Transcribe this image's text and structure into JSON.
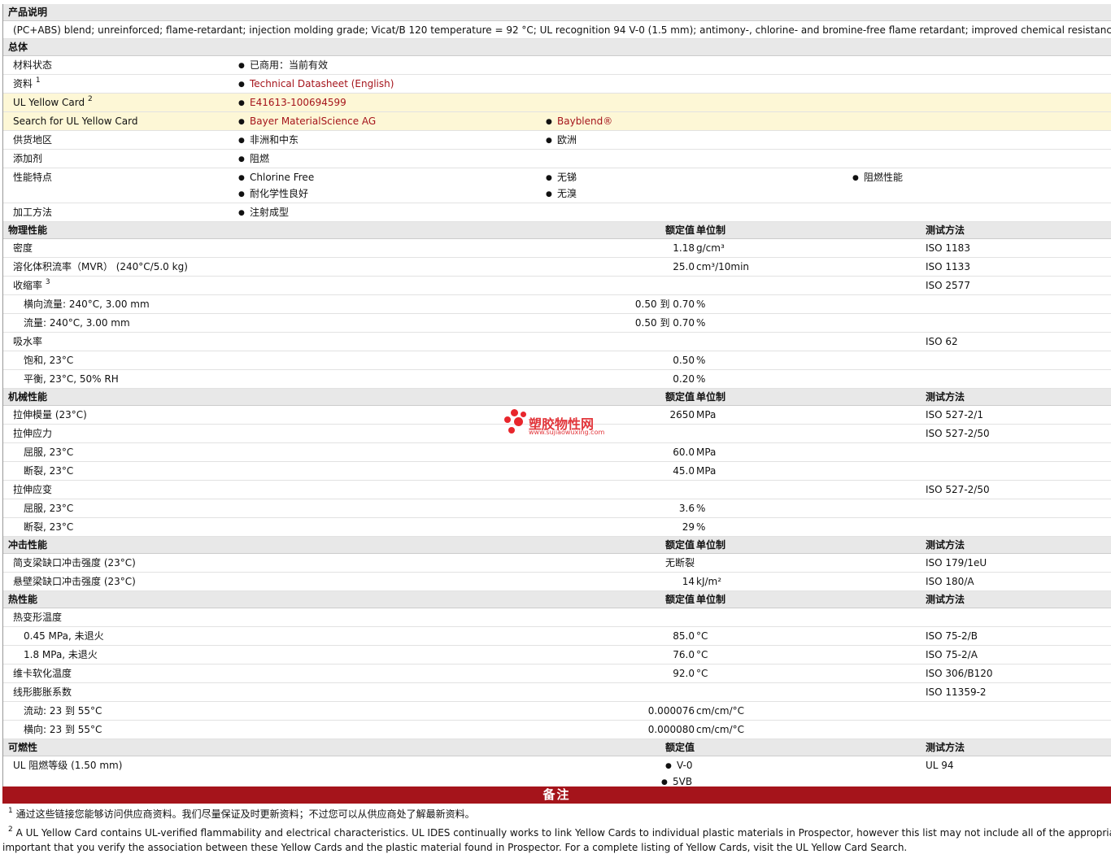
{
  "desc_header": "产品说明",
  "desc_text": "(PC+ABS) blend; unreinforced; flame-retardant; injection molding grade; Vicat/B 120 temperature = 92 °C; UL recognition 94 V-0 (1.5 mm); antimony-, chlorine- and bromine-free flame retardant; improved chemical resistance.",
  "general": {
    "header": "总体",
    "status_label": "材料状态",
    "status_value": "已商用：当前有效",
    "info_label": "资料",
    "info_sup": "1",
    "info_value": "Technical Datasheet (English)",
    "ul_label": "UL Yellow Card",
    "ul_sup": "2",
    "ul_value": "E41613-100694599",
    "search_label": "Search for UL Yellow Card",
    "search_v1": "Bayer MaterialScience AG",
    "search_v2": "Bayblend®",
    "region_label": "供货地区",
    "region_v1": "非洲和中东",
    "region_v2": "欧洲",
    "additive_label": "添加剂",
    "additive_v1": "阻燃",
    "feature_label": "性能特点",
    "feature_v1": "Chlorine Free",
    "feature_v2": "无锑",
    "feature_v3": "阻燃性能",
    "feature_v4": "耐化学性良好",
    "feature_v5": "无溴",
    "process_label": "加工方法",
    "process_v1": "注射成型"
  },
  "col_headers": {
    "value": "额定值",
    "unit": "单位制",
    "test": "测试方法"
  },
  "physical": {
    "header": "物理性能",
    "rows": [
      {
        "label": "密度",
        "value": "1.18",
        "unit": "g/cm³",
        "test": "ISO 1183"
      },
      {
        "label": "溶化体积流率（MVR） (240°C/5.0 kg)",
        "value": "25.0",
        "unit": "cm³/10min",
        "test": "ISO 1133"
      },
      {
        "label": "收缩率",
        "sup": "3",
        "value": "",
        "unit": "",
        "test": "ISO 2577"
      },
      {
        "label": "横向流量: 240°C, 3.00 mm",
        "value": "0.50 到  0.70",
        "unit": "%",
        "test": "",
        "sub": true
      },
      {
        "label": "流量: 240°C, 3.00 mm",
        "value": "0.50 到  0.70",
        "unit": "%",
        "test": "",
        "sub": true
      },
      {
        "label": "吸水率",
        "value": "",
        "unit": "",
        "test": "ISO 62"
      },
      {
        "label": "饱和, 23°C",
        "value": "0.50",
        "unit": "%",
        "test": "",
        "sub": true
      },
      {
        "label": "平衡, 23°C, 50% RH",
        "value": "0.20",
        "unit": "%",
        "test": "",
        "sub": true
      }
    ]
  },
  "mechanical": {
    "header": "机械性能",
    "rows": [
      {
        "label": "拉伸模量 (23°C)",
        "value": "2650",
        "unit": "MPa",
        "test": "ISO 527-2/1"
      },
      {
        "label": "拉伸应力",
        "value": "",
        "unit": "",
        "test": "ISO 527-2/50"
      },
      {
        "label": "屈服, 23°C",
        "value": "60.0",
        "unit": "MPa",
        "test": "",
        "sub": true
      },
      {
        "label": "断裂, 23°C",
        "value": "45.0",
        "unit": "MPa",
        "test": "",
        "sub": true
      },
      {
        "label": "拉伸应变",
        "value": "",
        "unit": "",
        "test": "ISO 527-2/50"
      },
      {
        "label": "屈服, 23°C",
        "value": "3.6",
        "unit": "%",
        "test": "",
        "sub": true
      },
      {
        "label": "断裂, 23°C",
        "value": "29",
        "unit": "%",
        "test": "",
        "sub": true
      }
    ]
  },
  "impact": {
    "header": "冲击性能",
    "rows": [
      {
        "label": "简支梁缺口冲击强度 (23°C)",
        "value": "无断裂",
        "unit": "",
        "test": "ISO 179/1eU"
      },
      {
        "label": "悬壁梁缺口冲击强度 (23°C)",
        "value": "14",
        "unit": "kJ/m²",
        "test": "ISO 180/A"
      }
    ]
  },
  "thermal": {
    "header": "热性能",
    "rows": [
      {
        "label": "热变形温度",
        "value": "",
        "unit": "",
        "test": ""
      },
      {
        "label": "0.45 MPa, 未退火",
        "value": "85.0",
        "unit": "°C",
        "test": "ISO 75-2/B",
        "sub": true
      },
      {
        "label": "1.8 MPa, 未退火",
        "value": "76.0",
        "unit": "°C",
        "test": "ISO 75-2/A",
        "sub": true
      },
      {
        "label": "维卡软化温度",
        "value": "92.0",
        "unit": "°C",
        "test": "ISO 306/B120"
      },
      {
        "label": "线形膨胀系数",
        "value": "",
        "unit": "",
        "test": "ISO 11359-2"
      },
      {
        "label": "流动: 23 到  55°C",
        "value": "0.000076",
        "unit": "cm/cm/°C",
        "test": "",
        "sub": true
      },
      {
        "label": "横向: 23 到  55°C",
        "value": "0.000080",
        "unit": "cm/cm/°C",
        "test": "",
        "sub": true
      }
    ]
  },
  "flammability": {
    "header": "可燃性",
    "label": "UL 阻燃等级 (1.50 mm)",
    "v1": "V-0",
    "v2": "5VB",
    "test": "UL 94"
  },
  "notes": {
    "header": "备注",
    "n1_sup": "1",
    "n1": "通过这些链接您能够访问供应商资料。我们尽量保证及时更新资料；不过您可以从供应商处了解最新资料。",
    "n2_sup": "2",
    "n2": "A UL Yellow Card contains UL-verified flammability and electrical characteristics. UL IDES continually works to link Yellow Cards to individual plastic materials in Prospector, however this list may not include all of the appropriate links",
    "n2b": "important that you verify the association between these Yellow Cards and the plastic material found in Prospector. For a complete listing of Yellow Cards, visit the UL Yellow Card Search."
  },
  "watermark": {
    "title": "塑胶物性网",
    "url": "www.sujiaowuxing.com",
    "color": "#e2363b"
  }
}
